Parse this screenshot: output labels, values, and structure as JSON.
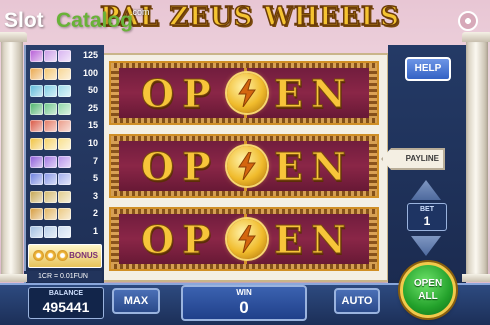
{
  "watermark": {
    "slot": "Slot",
    "catalog": "Catalog",
    "com": ".com"
  },
  "game": {
    "title": "PAL ZEUS WHEELS"
  },
  "paytable": {
    "rows": [
      {
        "value": "125",
        "colors": [
          "#b55ad6",
          "#c99ae6",
          "#d7b2f0"
        ]
      },
      {
        "value": "100",
        "colors": [
          "#e9a64a",
          "#f2c46c",
          "#f7d592"
        ]
      },
      {
        "value": "50",
        "colors": [
          "#5ab9d8",
          "#7acce3",
          "#9adbe9"
        ]
      },
      {
        "value": "25",
        "colors": [
          "#4bb36a",
          "#6cc689",
          "#8ed7a6"
        ]
      },
      {
        "value": "15",
        "colors": [
          "#d8533f",
          "#e3765f",
          "#ea9a86"
        ]
      },
      {
        "value": "10",
        "colors": [
          "#f0c13c",
          "#f4d062",
          "#f8df8a"
        ]
      },
      {
        "value": "7",
        "colors": [
          "#8a58d9",
          "#9f73e2",
          "#b590ea"
        ]
      },
      {
        "value": "5",
        "colors": [
          "#6a7ee0",
          "#8595e6",
          "#a1aded"
        ]
      },
      {
        "value": "3",
        "colors": [
          "#c4a44f",
          "#d3b86b",
          "#e1cc8a"
        ]
      },
      {
        "value": "2",
        "colors": [
          "#d59a3a",
          "#e1b25c",
          "#ebc87f"
        ]
      },
      {
        "value": "1",
        "colors": [
          "#9fbde0",
          "#b6cde8",
          "#cddcf0"
        ]
      }
    ],
    "bonus_label": "BONUS",
    "cr_value": "1CR = 0.01FUN"
  },
  "reels": {
    "rows": [
      {
        "left": "OP",
        "right": "EN"
      },
      {
        "left": "OP",
        "right": "EN"
      },
      {
        "left": "OP",
        "right": "EN"
      }
    ]
  },
  "right_panel": {
    "help_label": "HELP",
    "payline_label": "PAYLINE",
    "bet_label": "BET",
    "bet_value": "1"
  },
  "bottom": {
    "balance_label": "BALANCE",
    "balance_value": "495441",
    "max_label": "MAX",
    "win_label": "WIN",
    "win_value": "0",
    "auto_label": "AUTO",
    "open_all_line1": "OPEN",
    "open_all_line2": "ALL"
  },
  "colors": {
    "reel_background": "#8a2647",
    "gold": "#f7c53a",
    "panel_blue": "#243a66",
    "open_all_green": "#23a12b"
  }
}
